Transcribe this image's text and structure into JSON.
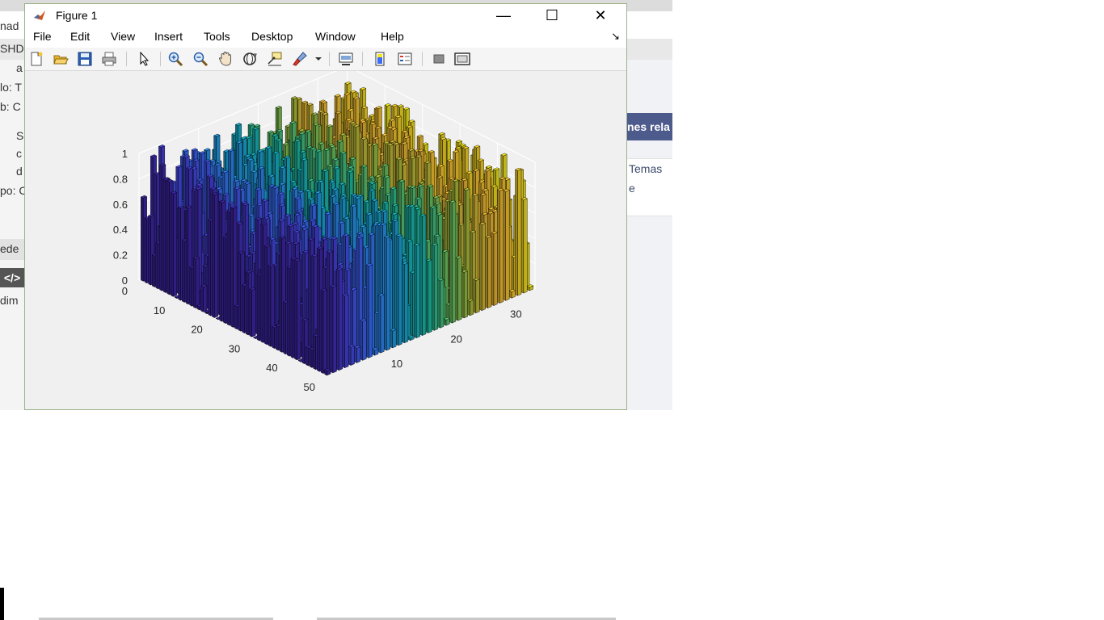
{
  "background": {
    "right_panel_header": "nes rela",
    "right_panel_links": [
      "Temas",
      "e"
    ],
    "left_snippets": [
      {
        "text": "nad"
      },
      {
        "text": "SHD"
      },
      {
        "text": "a"
      },
      {
        "text": "lo: T"
      },
      {
        "text": "b: C"
      },
      {
        "text": "S"
      },
      {
        "text": "c"
      },
      {
        "text": "d"
      },
      {
        "text": "po: C"
      },
      {
        "text": "ede"
      },
      {
        "text": "dim"
      }
    ],
    "code_button": "</>"
  },
  "window": {
    "title": "Figure 1",
    "minimize": "—",
    "maximize": "☐",
    "close": "✕"
  },
  "menu": {
    "items": [
      "File",
      "Edit",
      "View",
      "Insert",
      "Tools",
      "Desktop",
      "Window",
      "Help"
    ],
    "dock_glyph": "↘"
  },
  "toolbar": {
    "buttons": [
      {
        "name": "new-figure-icon"
      },
      {
        "name": "open-file-icon"
      },
      {
        "name": "save-icon"
      },
      {
        "name": "print-icon"
      },
      {
        "name": "select-arrow-icon"
      },
      {
        "name": "zoom-in-icon"
      },
      {
        "name": "zoom-out-icon"
      },
      {
        "name": "pan-hand-icon"
      },
      {
        "name": "rotate-3d-icon"
      },
      {
        "name": "data-cursor-icon"
      },
      {
        "name": "brush-icon"
      },
      {
        "name": "brush-dropdown-icon"
      },
      {
        "name": "link-plot-icon"
      },
      {
        "name": "colorbar-icon"
      },
      {
        "name": "legend-icon"
      },
      {
        "name": "hide-plot-tools-icon"
      },
      {
        "name": "show-plot-tools-icon"
      }
    ]
  },
  "chart_data": {
    "type": "bar3",
    "description_free": true,
    "zlim": [
      0,
      1
    ],
    "z_ticks": [
      "0",
      "0.2",
      "0.4",
      "0.6",
      "0.8",
      "1"
    ],
    "rows_axis": {
      "ticks": [
        "0",
        "10",
        "20",
        "30",
        "40",
        "50"
      ],
      "range": [
        0,
        50
      ]
    },
    "cols_axis": {
      "ticks": [
        "10",
        "20",
        "30"
      ],
      "range": [
        0,
        35
      ]
    },
    "n_rows": 50,
    "n_cols": 35,
    "colormap": [
      "#3e26a8",
      "#4743e0",
      "#3a6cf8",
      "#2795eb",
      "#17b0cf",
      "#1ebea3",
      "#60c56b",
      "#aac03b",
      "#e9b634",
      "#fec831",
      "#f3e81d"
    ],
    "values_note": "uniform random values in [0,1] (rand(50,35))",
    "grid": true
  }
}
